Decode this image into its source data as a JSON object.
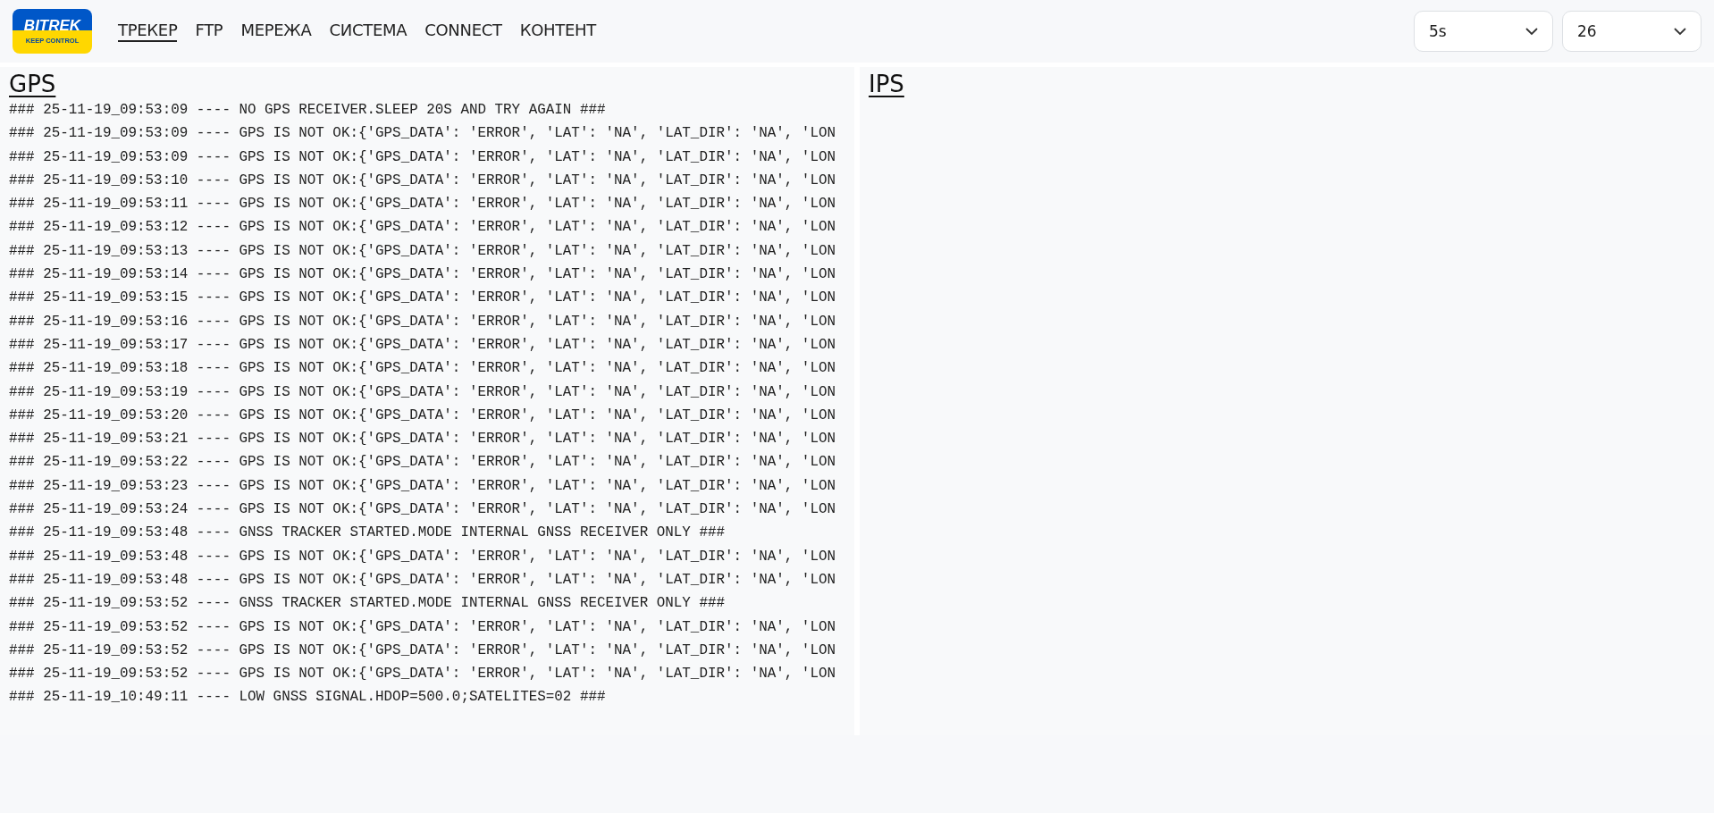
{
  "logo": {
    "name": "BITREK",
    "tagline": "KEEP CONTROL"
  },
  "nav": [
    {
      "label": "ТРЕКЕР",
      "selected": true
    },
    {
      "label": "FTP",
      "selected": false
    },
    {
      "label": "МЕРЕЖА",
      "selected": false
    },
    {
      "label": "СИСТЕМА",
      "selected": false
    },
    {
      "label": "CONNECT",
      "selected": false
    },
    {
      "label": "КОНТЕНТ",
      "selected": false
    }
  ],
  "selects": [
    {
      "value": "5s"
    },
    {
      "value": "26"
    }
  ],
  "panels": [
    {
      "title": "GPS",
      "lines": [
        "### 25-11-19_09:53:09 ---- NO GPS RECEIVER.SLEEP 20S AND TRY AGAIN ###",
        "### 25-11-19_09:53:09 ---- GPS IS NOT OK:{'GPS_DATA': 'ERROR', 'LAT': 'NA', 'LAT_DIR': 'NA', 'LON",
        "### 25-11-19_09:53:09 ---- GPS IS NOT OK:{'GPS_DATA': 'ERROR', 'LAT': 'NA', 'LAT_DIR': 'NA', 'LON",
        "### 25-11-19_09:53:10 ---- GPS IS NOT OK:{'GPS_DATA': 'ERROR', 'LAT': 'NA', 'LAT_DIR': 'NA', 'LON",
        "### 25-11-19_09:53:11 ---- GPS IS NOT OK:{'GPS_DATA': 'ERROR', 'LAT': 'NA', 'LAT_DIR': 'NA', 'LON",
        "### 25-11-19_09:53:12 ---- GPS IS NOT OK:{'GPS_DATA': 'ERROR', 'LAT': 'NA', 'LAT_DIR': 'NA', 'LON",
        "### 25-11-19_09:53:13 ---- GPS IS NOT OK:{'GPS_DATA': 'ERROR', 'LAT': 'NA', 'LAT_DIR': 'NA', 'LON",
        "### 25-11-19_09:53:14 ---- GPS IS NOT OK:{'GPS_DATA': 'ERROR', 'LAT': 'NA', 'LAT_DIR': 'NA', 'LON",
        "### 25-11-19_09:53:15 ---- GPS IS NOT OK:{'GPS_DATA': 'ERROR', 'LAT': 'NA', 'LAT_DIR': 'NA', 'LON",
        "### 25-11-19_09:53:16 ---- GPS IS NOT OK:{'GPS_DATA': 'ERROR', 'LAT': 'NA', 'LAT_DIR': 'NA', 'LON",
        "### 25-11-19_09:53:17 ---- GPS IS NOT OK:{'GPS_DATA': 'ERROR', 'LAT': 'NA', 'LAT_DIR': 'NA', 'LON",
        "### 25-11-19_09:53:18 ---- GPS IS NOT OK:{'GPS_DATA': 'ERROR', 'LAT': 'NA', 'LAT_DIR': 'NA', 'LON",
        "### 25-11-19_09:53:19 ---- GPS IS NOT OK:{'GPS_DATA': 'ERROR', 'LAT': 'NA', 'LAT_DIR': 'NA', 'LON",
        "### 25-11-19_09:53:20 ---- GPS IS NOT OK:{'GPS_DATA': 'ERROR', 'LAT': 'NA', 'LAT_DIR': 'NA', 'LON",
        "### 25-11-19_09:53:21 ---- GPS IS NOT OK:{'GPS_DATA': 'ERROR', 'LAT': 'NA', 'LAT_DIR': 'NA', 'LON",
        "### 25-11-19_09:53:22 ---- GPS IS NOT OK:{'GPS_DATA': 'ERROR', 'LAT': 'NA', 'LAT_DIR': 'NA', 'LON",
        "### 25-11-19_09:53:23 ---- GPS IS NOT OK:{'GPS_DATA': 'ERROR', 'LAT': 'NA', 'LAT_DIR': 'NA', 'LON",
        "### 25-11-19_09:53:24 ---- GPS IS NOT OK:{'GPS_DATA': 'ERROR', 'LAT': 'NA', 'LAT_DIR': 'NA', 'LON",
        "### 25-11-19_09:53:48 ---- GNSS TRACKER STARTED.MODE INTERNAL GNSS RECEIVER ONLY ###",
        "### 25-11-19_09:53:48 ---- GPS IS NOT OK:{'GPS_DATA': 'ERROR', 'LAT': 'NA', 'LAT_DIR': 'NA', 'LON",
        "### 25-11-19_09:53:48 ---- GPS IS NOT OK:{'GPS_DATA': 'ERROR', 'LAT': 'NA', 'LAT_DIR': 'NA', 'LON",
        "### 25-11-19_09:53:52 ---- GNSS TRACKER STARTED.MODE INTERNAL GNSS RECEIVER ONLY ###",
        "### 25-11-19_09:53:52 ---- GPS IS NOT OK:{'GPS_DATA': 'ERROR', 'LAT': 'NA', 'LAT_DIR': 'NA', 'LON",
        "### 25-11-19_09:53:52 ---- GPS IS NOT OK:{'GPS_DATA': 'ERROR', 'LAT': 'NA', 'LAT_DIR': 'NA', 'LON",
        "### 25-11-19_09:53:52 ---- GPS IS NOT OK:{'GPS_DATA': 'ERROR', 'LAT': 'NA', 'LAT_DIR': 'NA', 'LON",
        "### 25-11-19_10:49:11 ---- LOW GNSS SIGNAL.HDOP=500.0;SATELITES=02 ###"
      ]
    },
    {
      "title": "IPS"
    }
  ]
}
